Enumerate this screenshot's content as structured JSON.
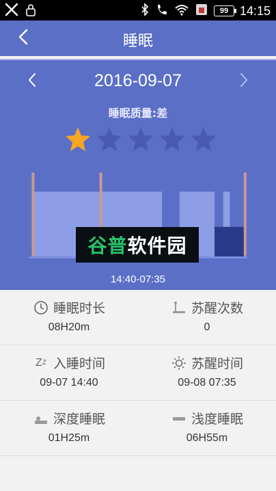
{
  "status_bar": {
    "time": "14:15",
    "battery": "99",
    "icons": [
      "app-icon",
      "lock-icon",
      "bluetooth-icon",
      "phone-icon",
      "wifi-icon",
      "notification-icon"
    ]
  },
  "header": {
    "title": "睡眠",
    "back_icon": "chevron-left-icon"
  },
  "date_nav": {
    "date": "2016-09-07",
    "prev_icon": "chevron-left-icon",
    "next_icon": "chevron-right-icon"
  },
  "quality": {
    "text": "睡眠质量:差",
    "rating": 1,
    "max_rating": 5,
    "filled_color": "#f5a623",
    "empty_color": "#4a5ab0"
  },
  "chart_data": {
    "type": "bar",
    "time_range": "14:40-07:35",
    "segments": [
      {
        "kind": "light",
        "start": 0.02,
        "end": 0.61
      },
      {
        "kind": "light",
        "start": 0.69,
        "end": 0.85
      },
      {
        "kind": "light",
        "start": 0.89,
        "end": 0.92
      },
      {
        "kind": "deep",
        "start": 0.85,
        "end": 0.99
      }
    ],
    "markers": [
      0.02,
      0.33,
      0.99
    ],
    "colors": {
      "light": "#8e9ee6",
      "deep": "#2a3a8a",
      "marker": "#c89a8f"
    }
  },
  "watermark": {
    "green": "谷普",
    "white": "软件园"
  },
  "stats": {
    "sleep_duration": {
      "label": "睡眠时长",
      "value": "08H20m",
      "icon": "clock-icon"
    },
    "wake_count": {
      "label": "苏醒次数",
      "value": "0",
      "icon": "wake-bed-icon"
    },
    "sleep_time": {
      "label": "入睡时间",
      "value": "09-07 14:40",
      "icon": "zz-icon",
      "icon_text": "Z"
    },
    "wake_time": {
      "label": "苏醒时间",
      "value": "09-08 07:35",
      "icon": "sun-icon"
    },
    "deep_sleep": {
      "label": "深度睡眠",
      "value": "01H25m",
      "icon": "deep-sleep-icon"
    },
    "light_sleep": {
      "label": "浅度睡眠",
      "value": "06H55m",
      "icon": "light-sleep-icon"
    }
  }
}
